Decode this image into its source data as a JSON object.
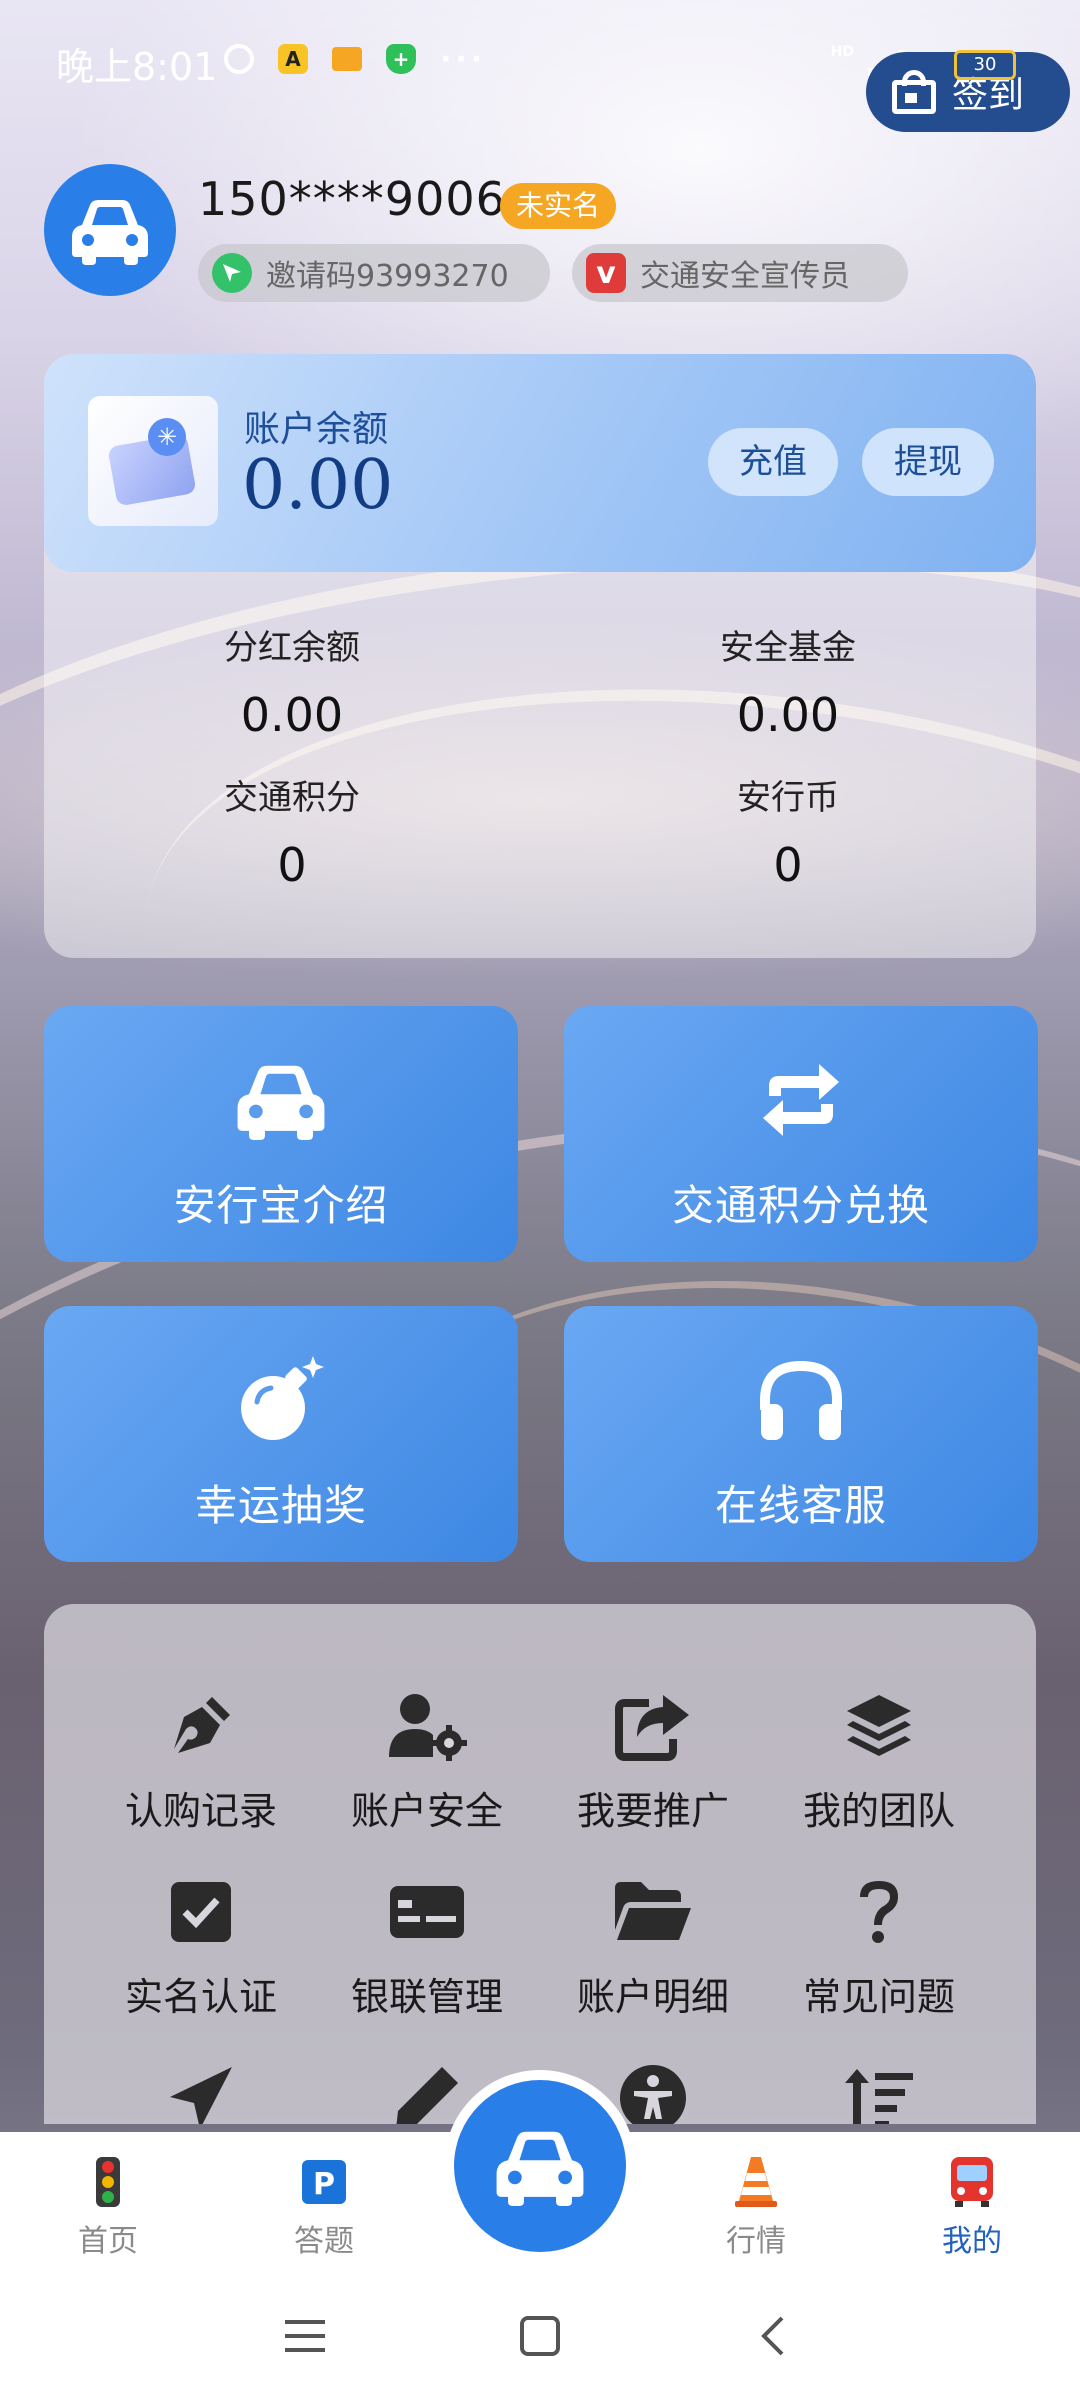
{
  "status_bar": {
    "time": "晚上8:01",
    "dots": "···",
    "battery": "30",
    "network": "HD"
  },
  "signin": {
    "label": "签到"
  },
  "profile": {
    "phone": "150****9006",
    "badge": "未实名",
    "invite_code": "邀请码93993270",
    "role": "交通安全宣传员"
  },
  "balance": {
    "label": "账户余额",
    "value": "0.00",
    "recharge": "充值",
    "withdraw": "提现"
  },
  "stats": [
    {
      "label": "分红余额",
      "value": "0.00"
    },
    {
      "label": "安全基金",
      "value": "0.00"
    },
    {
      "label": "交通积分",
      "value": "0"
    },
    {
      "label": "安行币",
      "value": "0"
    }
  ],
  "tiles": [
    {
      "label": "安行宝介绍",
      "icon": "car-icon"
    },
    {
      "label": "交通积分兑换",
      "icon": "exchange-icon"
    },
    {
      "label": "幸运抽奖",
      "icon": "bomb-icon"
    },
    {
      "label": "在线客服",
      "icon": "headphones-icon"
    }
  ],
  "menu": [
    {
      "label": "认购记录",
      "icon": "pen-nib-icon"
    },
    {
      "label": "账户安全",
      "icon": "user-gear-icon"
    },
    {
      "label": "我要推广",
      "icon": "share-icon"
    },
    {
      "label": "我的团队",
      "icon": "layers-icon"
    },
    {
      "label": "实名认证",
      "icon": "check-square-icon"
    },
    {
      "label": "银联管理",
      "icon": "card-icon"
    },
    {
      "label": "账户明细",
      "icon": "folder-open-icon"
    },
    {
      "label": "常见问题",
      "icon": "question-icon"
    },
    {
      "label": "",
      "icon": "paper-plane-icon"
    },
    {
      "label": "",
      "icon": "pencil-icon"
    },
    {
      "label": "",
      "icon": "accessibility-icon"
    },
    {
      "label": "",
      "icon": "sort-icon"
    }
  ],
  "bottom_nav": [
    {
      "label": "首页",
      "icon": "traffic-light-icon",
      "active": false
    },
    {
      "label": "答题",
      "icon": "parking-icon",
      "active": false
    },
    {
      "label": "",
      "icon": "car-icon",
      "active": false
    },
    {
      "label": "行情",
      "icon": "traffic-cone-icon",
      "active": false
    },
    {
      "label": "我的",
      "icon": "bus-icon",
      "active": true
    }
  ],
  "colors": {
    "accent": "#2a7ee8",
    "tile": "#4a92e8",
    "badge": "#f5a623",
    "signin": "#234d8f",
    "nav_active": "#2363b9"
  }
}
